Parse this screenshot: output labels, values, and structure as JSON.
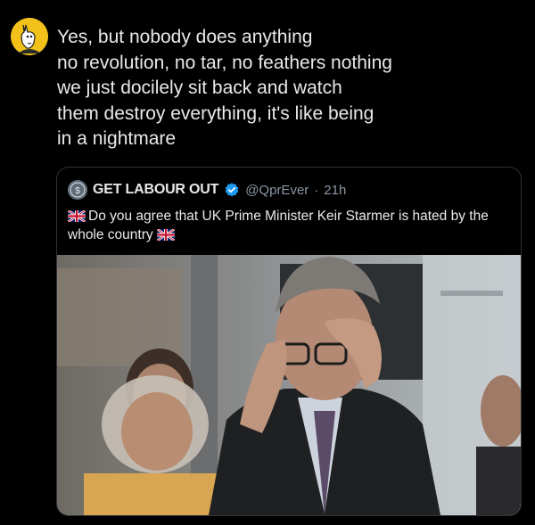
{
  "post": {
    "avatar_icon": "llama-avatar-icon",
    "text_lines": [
      "Yes, but nobody does anything",
      "no revolution, no tar, no feathers nothing",
      "we just docilely sit back and watch",
      "them destroy everything, it's like being",
      "in a nightmare"
    ]
  },
  "quote": {
    "author_name": "GET LABOUR OUT",
    "verified_icon": "verified-badge-icon",
    "handle": "@QprEver",
    "separator": "·",
    "time": "21h",
    "flag_icon": "uk-flag-icon",
    "text_line1": "Do you agree that UK Prime Minister Keir Starmer is hated by the",
    "text_line2": "whole country",
    "image_alt": "photo-man-holding-head"
  },
  "colors": {
    "background": "#000000",
    "text": "#e7e9ea",
    "secondary_text": "#8b98a5",
    "border": "#2f3336",
    "verified": "#1d9bf0",
    "avatar_bg": "#f2c21b"
  }
}
